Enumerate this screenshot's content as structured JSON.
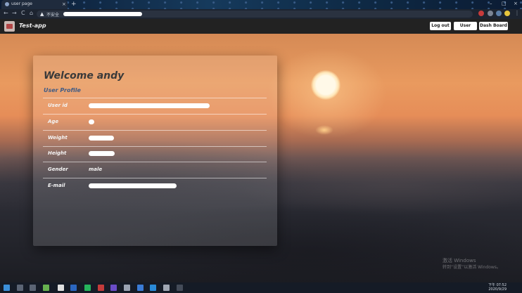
{
  "browser": {
    "tab_title": "user page",
    "new_tab": "+",
    "tab_close": "×",
    "window_controls": [
      "–",
      "□",
      "×"
    ],
    "nav_buttons": [
      "←",
      "→",
      "C",
      "⌂"
    ],
    "security_warning": "不安全"
  },
  "app": {
    "brand": "Test-app",
    "nav_links": [
      "Log out",
      "User Page",
      "Dash Board"
    ]
  },
  "profile": {
    "welcome": "Welcome andy",
    "subtitle": "User Profile",
    "rows": [
      {
        "label": "User id",
        "value": ""
      },
      {
        "label": "Age",
        "value": ""
      },
      {
        "label": "Weight",
        "value": ""
      },
      {
        "label": "Height",
        "value": ""
      },
      {
        "label": "Gender",
        "value": "male"
      },
      {
        "label": "E-mail",
        "value": ""
      }
    ]
  },
  "watermark": {
    "line1": "激活 Windows",
    "line2": "转到“设置”以激活 Windows。"
  },
  "clock": {
    "time": "下午 07:52",
    "date": "2020/9/29"
  },
  "colors": {
    "accent": "#3f5b85",
    "navbar": "#222222"
  }
}
